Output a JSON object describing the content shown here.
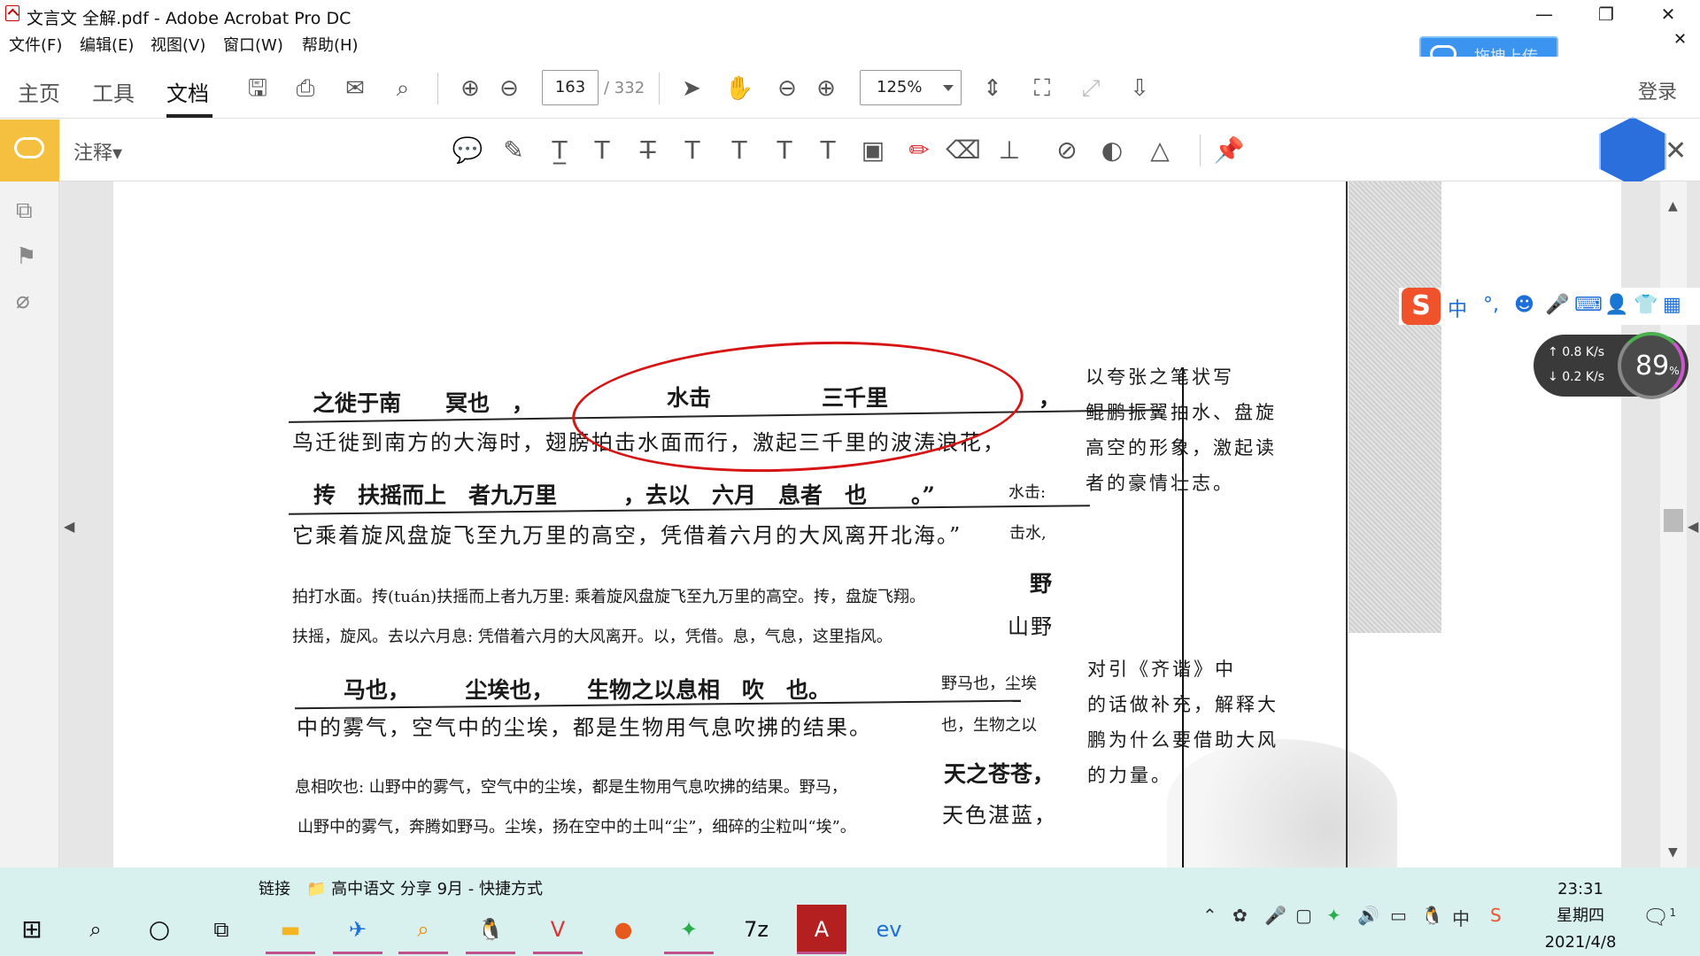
{
  "window": {
    "title": "文言文 全解.pdf - Adobe Acrobat Pro DC"
  },
  "menu": [
    "文件(F)",
    "编辑(E)",
    "视图(V)",
    "窗口(W)",
    "帮助(H)"
  ],
  "tabs": [
    "主页",
    "工具",
    "文档"
  ],
  "page": {
    "current": "163",
    "total": "/ 332"
  },
  "zoom": "125%",
  "upload_label": "拖拽上传",
  "login": "登录",
  "annotation_label": "注释▾",
  "ime": {
    "lang": "中",
    "punct": "°,"
  },
  "net": {
    "up": "0.8",
    "down": "0.2",
    "unit": "K/s",
    "percent": "89",
    "pct_sign": "%"
  },
  "doc": {
    "l1": "之徙于南　　冥也　，",
    "l1b": "水击　　　　　三千里",
    "l1c": "，",
    "l2": "鸟迁徙到南方的大海时，翅膀拍击水面而行，激起三千里的波涛浪花，",
    "l3": "抟　扶摇而上　者九万里　　　，去以　六月　息者　也　　。”",
    "l3note": "水击:",
    "l4": "它乘着旋风盘旋飞至九万里的高空，凭借着六月的大风离开北海。”",
    "l4note": "击水,",
    "l5": "拍打水面。抟(tuán)扶摇而上者九万里: 乘着旋风盘旋飞至九万里的高空。抟，盘旋飞翔。",
    "l5note": "野",
    "l6": "扶摇，旋风。去以六月息: 凭借着六月的大风离开。以，凭借。息，气息，这里指风。",
    "l6note": "山野",
    "l7": "马也，　　　尘埃也，　　生物之以息相　吹　也。",
    "l7note": "野马也，尘埃",
    "l8": "中的雾气，空气中的尘埃，都是生物用气息吹拂的结果。",
    "l8note": "也，生物之以",
    "l9": "息相吹也: 山野中的雾气，空气中的尘埃，都是生物用气息吹拂的结果。野马，",
    "l9note": "天之苍苍，",
    "l10": "山野中的雾气，奔腾如野马。尘埃，扬在空中的土叫“尘”，细碎的尘粒叫“埃”。",
    "l10note": "天色湛蓝，",
    "side1": [
      "以夸张之笔状写",
      "鲲鹏振翼拍水、盘旋",
      "高空的形象，激起读",
      "者的豪情壮志。"
    ],
    "side2": [
      "对引《齐谐》中",
      "的话做补充，解释大",
      "鹏为什么要借助大风",
      "的力量。"
    ]
  },
  "taskbar": {
    "title_prefix": "链接",
    "title": "高中语文 分享 9月 - 快捷方式",
    "time": "23:31",
    "weekday": "星期四",
    "date": "2021/4/8",
    "notif_count": "1"
  }
}
